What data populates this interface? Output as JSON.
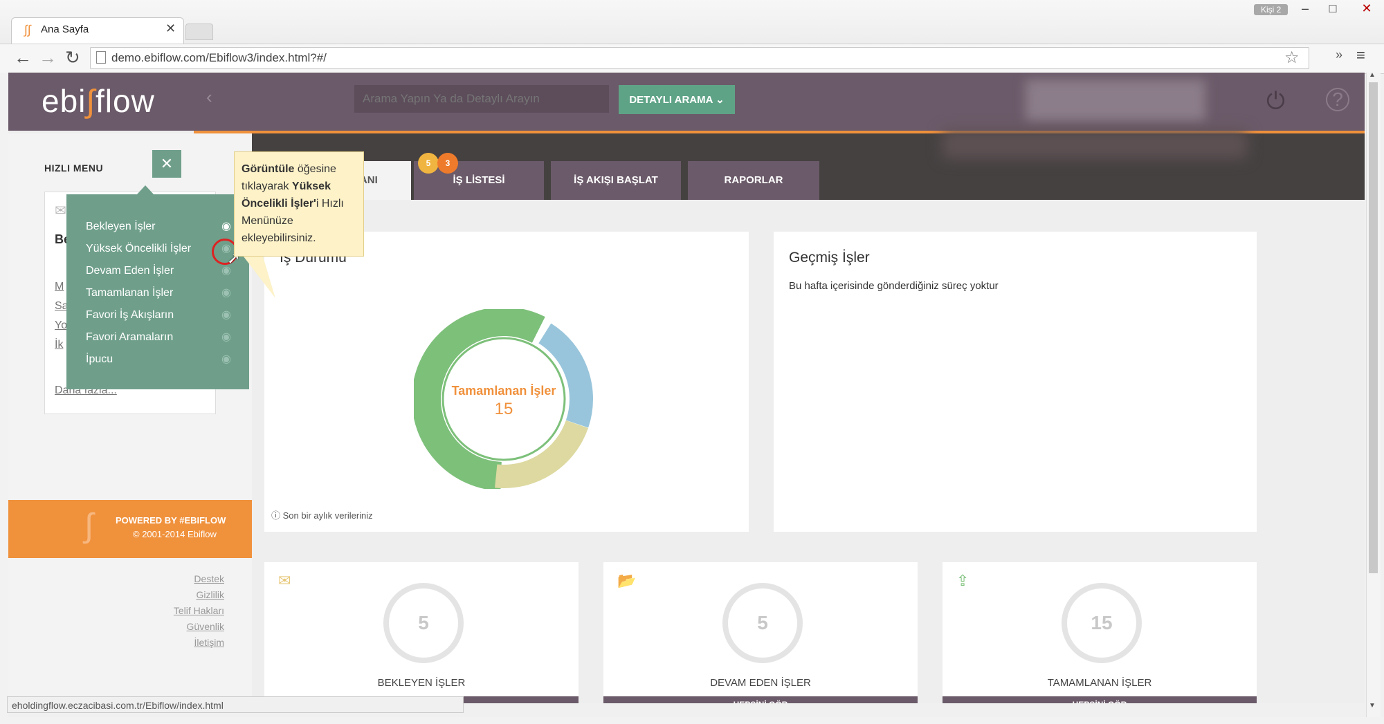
{
  "browser": {
    "tab_title": "Ana Sayfa",
    "tab_icon": "∫∫",
    "tab_close": "✕",
    "profile_badge": "Kişi 2",
    "win_min": "–",
    "win_max": "□",
    "win_close": "✕",
    "back": "←",
    "forward": "→",
    "reload": "↻",
    "url": "demo.ebiflow.com/Ebiflow3/index.html?#/",
    "star": "☆",
    "more": "»",
    "menu": "≡",
    "status_url": "eholdingflow.eczacibasi.com.tr/Ebiflow/index.html"
  },
  "header": {
    "logo_left": "ebi",
    "logo_slash": "∫",
    "logo_right": "flow",
    "search_prev": "‹",
    "search_placeholder": "Arama Yapın Ya da Detaylı Arayın",
    "detayli_label": "DETAYLI ARAMA ⌄",
    "power": "⏻",
    "help": "?"
  },
  "tabs": [
    {
      "label": "ANA EKRANI"
    },
    {
      "label": "İŞ LİSTESİ"
    },
    {
      "label": "İŞ AKIŞI BAŞLAT"
    },
    {
      "label": "RAPORLAR"
    }
  ],
  "badges": [
    "5",
    "3"
  ],
  "sidebar": {
    "title": "HIZLI MENU",
    "close": "✕",
    "card_heading": "Be",
    "card_links": [
      "M",
      "Sa",
      "Yo",
      "İk"
    ],
    "more": "Daha fazla...",
    "powered_line1": "POWERED BY #EBIFLOW",
    "powered_line2": "© 2001-2014 Ebiflow",
    "footer_links": [
      "Destek",
      "Gizlilik",
      "Telif Hakları",
      "Güvenlik",
      "İletişim"
    ]
  },
  "quick_menu": {
    "items": [
      {
        "label": "Bekleyen İşler",
        "eye": "◉"
      },
      {
        "label": "Yüksek Öncelikli İşler",
        "eye": "◉"
      },
      {
        "label": "Devam Eden İşler",
        "eye": "◉"
      },
      {
        "label": "Tamamlanan İşler",
        "eye": "◉"
      },
      {
        "label": "Favori İş Akışların",
        "eye": "◉"
      },
      {
        "label": "Favori Aramaların",
        "eye": "◉"
      },
      {
        "label": "İpucu",
        "eye": "◉"
      }
    ]
  },
  "tooltip": {
    "b1": "Görüntüle",
    "t1": " öğesine tıklayarak ",
    "b2": "Yüksek Öncelikli İşler'",
    "t2": "i Hızlı Menünüze ekleyebilirsiniz."
  },
  "is_durumu": {
    "title": "İş Durumu",
    "center_label": "Tamamlanan İşler",
    "center_value": "15",
    "note": "ⓘ Son bir aylık verileriniz",
    "colors": {
      "green": "#7dc07a",
      "blue": "#98c5db",
      "beige": "#ddd9a0",
      "orange": "#f0913c"
    }
  },
  "gecmis": {
    "title": "Geçmiş İşler",
    "text": "Bu hafta içerisinde gönderdiğiniz süreç yoktur"
  },
  "stats": [
    {
      "icon": "✉",
      "value": "5",
      "label": "BEKLEYEN İŞLER",
      "bar": ""
    },
    {
      "icon": "📂",
      "value": "5",
      "label": "DEVAM EDEN İŞLER",
      "bar": "HEPSİNİ GÖR"
    },
    {
      "icon": "⇪",
      "value": "15",
      "label": "TAMAMLANAN İŞLER",
      "bar": "HEPSİNİ GÖR"
    }
  ]
}
